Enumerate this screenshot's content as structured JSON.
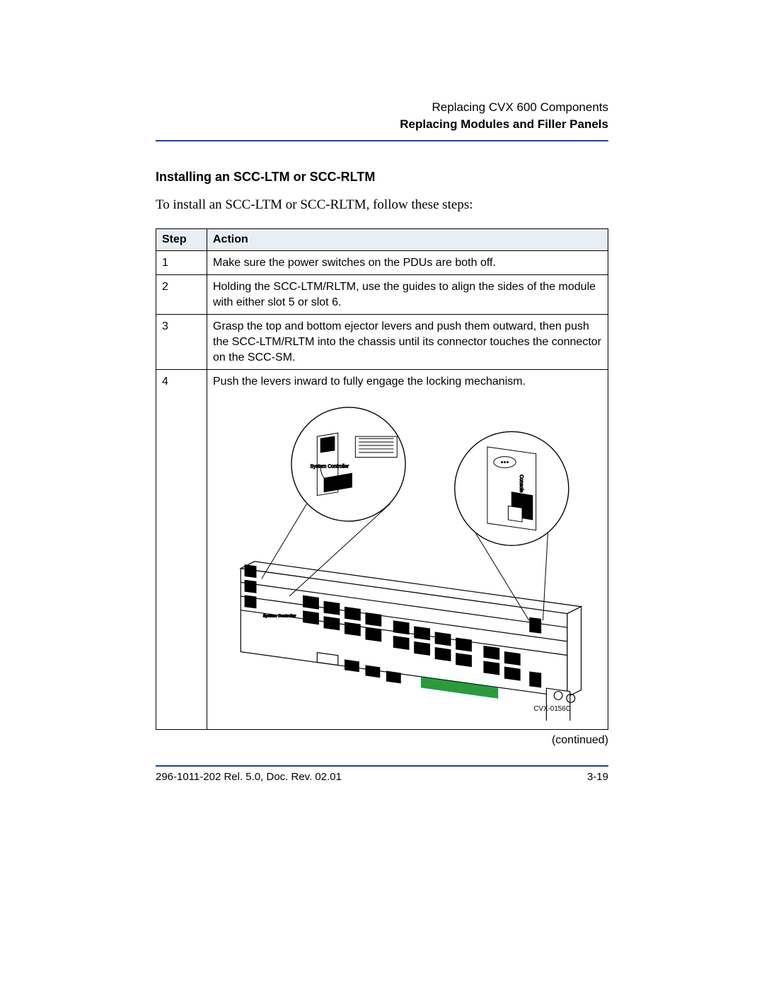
{
  "header": {
    "chapter": "Replacing CVX 600 Components",
    "section": "Replacing Modules and Filler Panels"
  },
  "title": "Installing an SCC-LTM or SCC-RLTM",
  "intro": "To install an SCC-LTM or SCC-RLTM, follow these steps:",
  "table": {
    "col_step": "Step",
    "col_action": "Action",
    "rows": [
      {
        "step": "1",
        "action": "Make sure the power switches on the PDUs are both off."
      },
      {
        "step": "2",
        "action": "Holding the SCC-LTM/RLTM, use the guides to align the sides of the module with either slot 5 or slot 6."
      },
      {
        "step": "3",
        "action": "Grasp the top and bottom ejector levers and push them outward, then push the SCC-LTM/RLTM into the chassis until its connector touches the connector on the SCC-SM."
      },
      {
        "step": "4",
        "action": "Push the levers inward to fully engage the locking mechanism."
      }
    ]
  },
  "figure": {
    "code": "CVX-0156C",
    "label_system": "System Controller",
    "label_console": "Console"
  },
  "continued": "(continued)",
  "footer": {
    "left": "296-1011-202 Rel. 5.0, Doc. Rev. 02.01",
    "right": "3-19"
  }
}
